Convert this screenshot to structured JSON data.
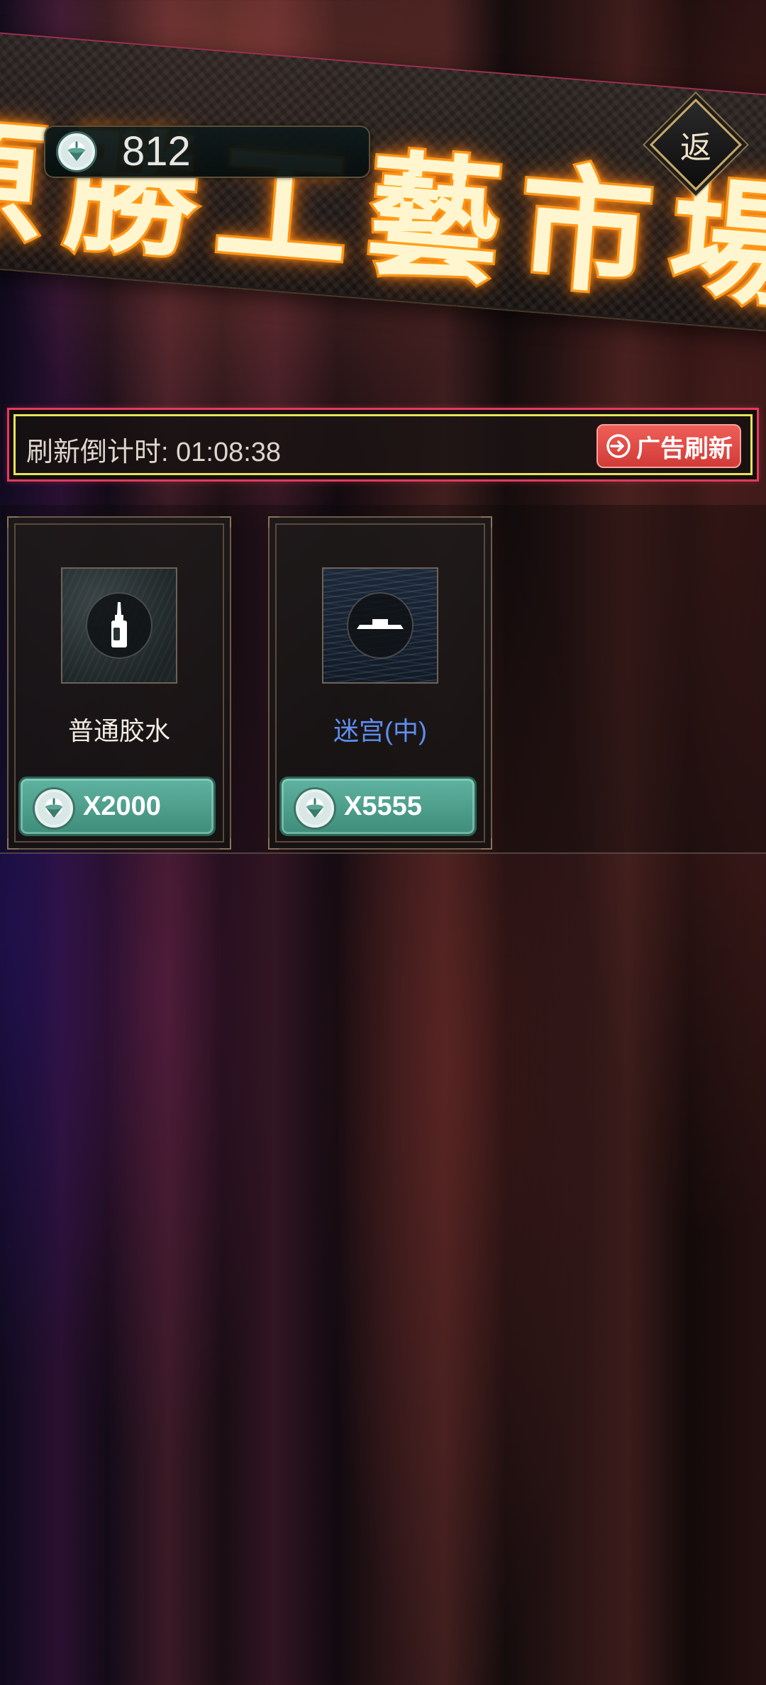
{
  "header": {
    "banner_title": "原勝工藝市場",
    "currency": {
      "icon": "spinning-top-coin-icon",
      "value": "812"
    },
    "return_button": {
      "label": "返"
    }
  },
  "refresh": {
    "countdown_label": "刷新倒计时:",
    "countdown_value": "01:08:38",
    "countdown_text": "刷新倒计时: 01:08:38",
    "ad_refresh_label": "广告刷新",
    "ad_refresh_icon": "refresh-arrow-icon",
    "accent_color": "#e23b5d"
  },
  "shop": {
    "items": [
      {
        "name": "普通胶水",
        "name_color": "#f2ece2",
        "icon": "glue-bottle-icon",
        "price": "X2000",
        "currency_icon": "spinning-top-coin-icon"
      },
      {
        "name": "迷宫(中)",
        "name_color": "#5f8ef0",
        "icon": "maze-platform-icon",
        "price": "X5555",
        "currency_icon": "spinning-top-coin-icon"
      }
    ]
  }
}
